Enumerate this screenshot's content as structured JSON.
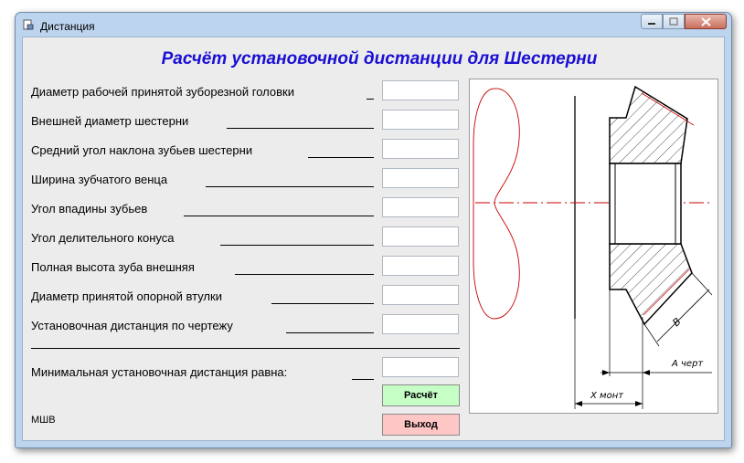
{
  "window": {
    "title": "Дистанция",
    "controls": [
      "minimize-icon",
      "maximize-icon",
      "close-icon"
    ]
  },
  "heading": "Расчёт установочной дистанции для Шестерни",
  "fields": [
    {
      "label": "Диаметр рабочей принятой зуборезной головки",
      "value": ""
    },
    {
      "label": "Внешней диаметр шестерни",
      "value": ""
    },
    {
      "label": "Средний угол наклона зубьев шестерни",
      "value": ""
    },
    {
      "label": "Ширина зубчатого венца",
      "value": ""
    },
    {
      "label": "Угол впадины зубьев",
      "value": ""
    },
    {
      "label": "Угол делительного конуса",
      "value": ""
    },
    {
      "label": "Полная высота зуба внешняя",
      "value": ""
    },
    {
      "label": "Диаметр принятой опорной втулки",
      "value": ""
    },
    {
      "label": "Установочная дистанция по чертежу",
      "value": ""
    }
  ],
  "result": {
    "label": "Минимальная установочная дистанция равна:",
    "value": ""
  },
  "buttons": {
    "calculate": "Расчёт",
    "exit": "Выход"
  },
  "footer": "МШВ",
  "drawing": {
    "label_b": "B",
    "label_a": "А черт",
    "label_x": "Х монт"
  },
  "colors": {
    "heading": "#1a0fd4",
    "calculate_bg": "#c6ffc6",
    "exit_bg": "#ffc6c6",
    "axis": "#c80000"
  }
}
